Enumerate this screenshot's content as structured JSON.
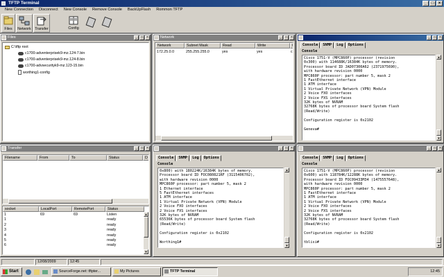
{
  "window": {
    "title": "TFTP Terminal"
  },
  "menu": [
    "New Connection",
    "Disconnect",
    "New Console",
    "Remove Console",
    "BackUpFlash",
    "Rommon TFTP"
  ],
  "toolbar": {
    "buttons": [
      {
        "label": "Files",
        "icon": "files-icon"
      },
      {
        "label": "Network",
        "icon": "network-icon"
      },
      {
        "label": "Transfer",
        "icon": "transfer-icon"
      },
      {
        "label": "Config",
        "icon": "config-icon"
      }
    ]
  },
  "files": {
    "title": "Files",
    "root": "C:\\tftp root",
    "items": [
      "c1700-adventerprisek9-mz.124-7.bin",
      "c1700-adventerprisek9-mz.124-8.bin",
      "c1700-advsecurityk9-mz.123-15.bin",
      "worthing1-config"
    ]
  },
  "network": {
    "title": "Network",
    "columns": [
      "Network",
      "Subnet Mask",
      "Read",
      "Write",
      "F"
    ],
    "rows": [
      [
        "172.25.0.0",
        "255.255.255.0",
        "yes",
        "yes",
        "c"
      ]
    ]
  },
  "transfer": {
    "title": "Transfer",
    "columns": [
      "Filename",
      "From",
      "To",
      "Status",
      "D"
    ],
    "socket_columns": [
      "socket",
      "LocalPort",
      "RemotePort",
      "Status"
    ],
    "socket_rows": [
      [
        "1",
        "69",
        "69",
        "Listen"
      ],
      [
        "1",
        "",
        "",
        "ready"
      ],
      [
        "2",
        "",
        "",
        "ready"
      ],
      [
        "3",
        "",
        "",
        "ready"
      ],
      [
        "4",
        "",
        "",
        "ready"
      ],
      [
        "5",
        "",
        "",
        "ready"
      ],
      [
        "6",
        "",
        "",
        "ready"
      ]
    ]
  },
  "tabs": [
    "Console",
    "SNMP",
    "Log",
    "Options"
  ],
  "consoles": [
    {
      "label": "Console",
      "text": "Cisco 1751-V (MPC860P) processor (revision\n0x300) with 114688K/16384K bytes of memory.\nProcessor board ID JAD07300A62 (2371975690),\nwith hardware revision 0000\nMPC860P processor: part number 5, mask 2\n1 FastEthernet interface\n1 ATM interface\n1 Virtual Private Network (VPN) Module\n2 Voice FXO interfaces\n2 Voice FXS interfaces\n32K bytes of NVRAM\n32768K bytes of processor board System flash\n(Read/Write)\n\nConfiguration register is 0x2102\n\nGeneva#"
    },
    {
      "label": "Console",
      "text": "0x800) with 180224K/16384K bytes of memory.\nProcessor board ID FOC080821RF (3115406702),\nwith hardware revision 0000\nMPC860P processor: part number 5, mask 2\n1 Ethernet interface\n5 FastEthernet interfaces\n1 ATM interface\n1 Virtual Private Network (VPN) Module\n2 Voice FXO interfaces\n2 Voice FXS interfaces\n32K bytes of NVRAM\n65536K bytes of processor board System flash\n(Read/Write)\n\nConfiguration register is 0x2102\n\nWorthing1#"
    },
    {
      "label": "Console",
      "text": "Cisco 1751-V (MPC860P) processor (revision\n0x600) with 118784K/12288K bytes of memory.\nProcessor board ID FOC09433M34 (1475557648),\nwith hardware revision 0000\nMPC860P processor: part number 5, mask 2\n1 FastEthernet interface\n1 ATM interface\n1 Virtual Private Network (VPN) Module\n2 Voice FXO interfaces\n2 Voice FXS interfaces\n32K bytes of NVRAM\n32768K bytes of processor board System flash\n(Read/Write)\n\nConfiguration register is 0x2102\n\ntblisi#"
    }
  ],
  "statusbar": {
    "date": "12/08/2009",
    "time": "12:45"
  },
  "taskbar": {
    "start": "Start",
    "items": [
      "SourceForge.net: tftpter...",
      "My Pictures",
      "TFTP Terminal"
    ],
    "clock": "12:45"
  },
  "colors": {
    "active_title": "#0a246a",
    "inactive_title": "#808080",
    "face": "#d4d0c8"
  }
}
